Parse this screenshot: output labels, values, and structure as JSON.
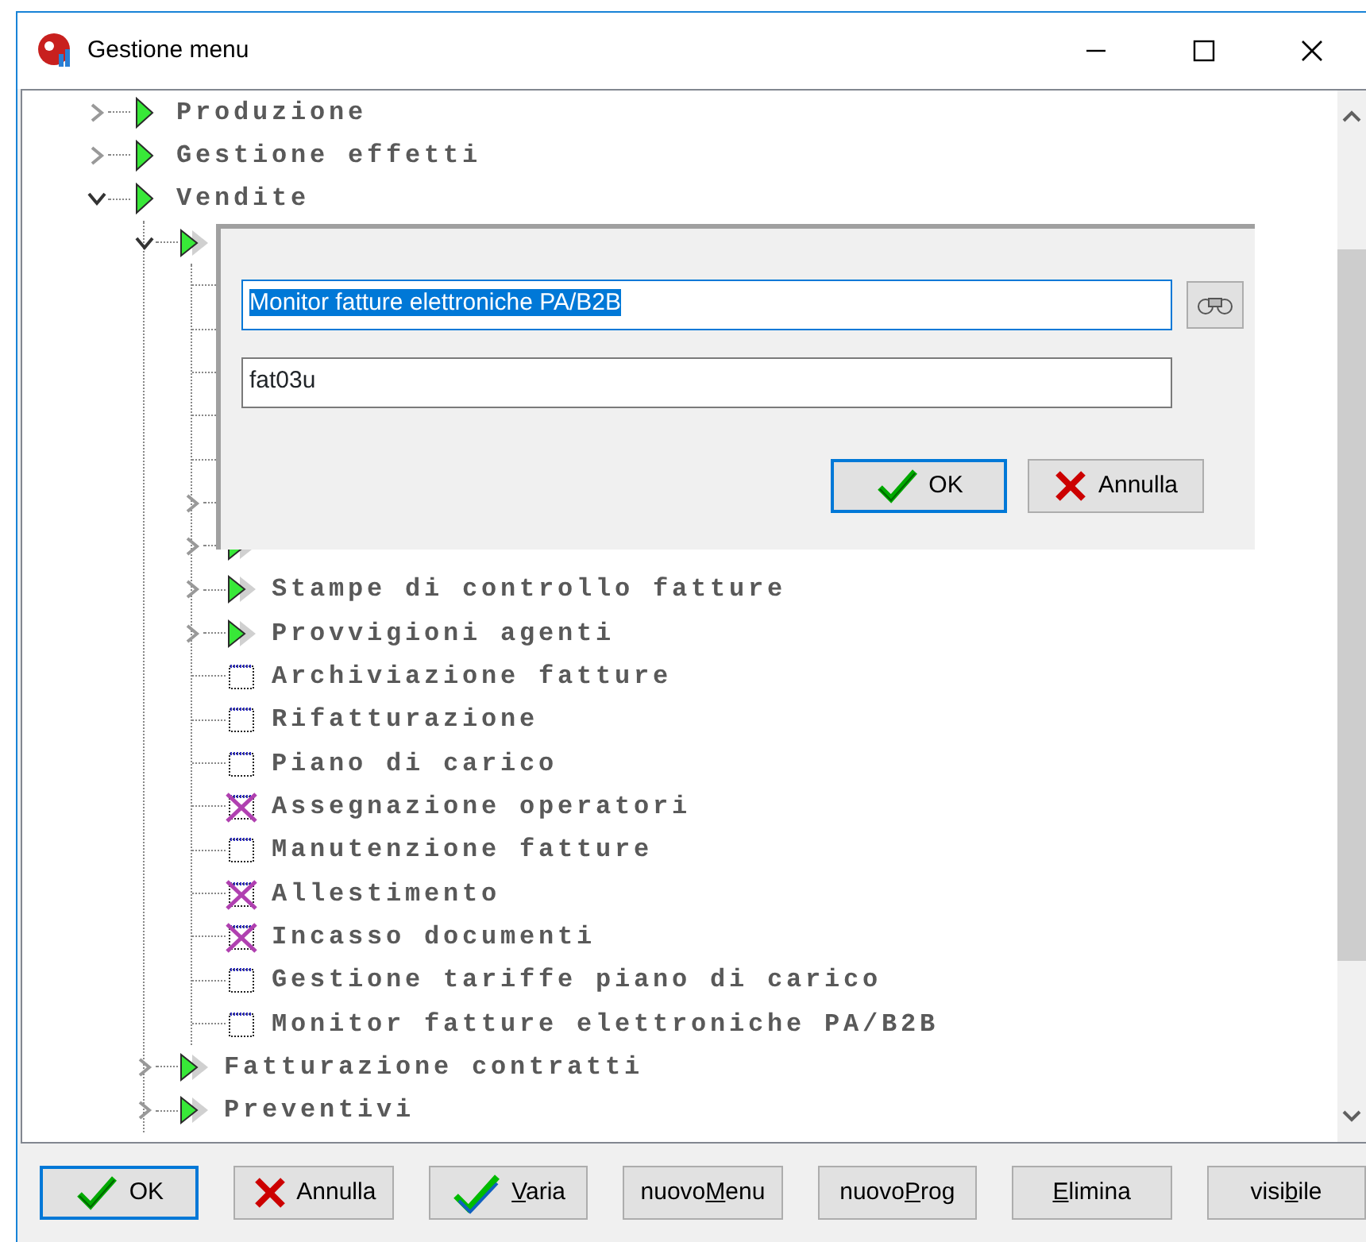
{
  "window": {
    "title": "Gestione menu"
  },
  "tree": [
    {
      "label": "Produzione",
      "kind": "menu",
      "expanded": false
    },
    {
      "label": "Gestione effetti",
      "kind": "menu",
      "expanded": false
    },
    {
      "label": "Vendite",
      "kind": "menu",
      "expanded": true,
      "children": [
        {
          "kind": "submenu",
          "expanded": true,
          "children": [
            {
              "kind": "covered"
            },
            {
              "kind": "covered"
            },
            {
              "kind": "covered"
            },
            {
              "kind": "covered"
            },
            {
              "kind": "covered"
            },
            {
              "kind": "covered-submenu",
              "expanded": false
            },
            {
              "kind": "submenu",
              "expanded": false
            },
            {
              "label": "Stampe di controllo fatture",
              "kind": "submenu",
              "expanded": false
            },
            {
              "label": "Provvigioni agenti",
              "kind": "submenu",
              "expanded": false
            },
            {
              "label": "Archiviazione fatture",
              "kind": "program",
              "excluded": false
            },
            {
              "label": "Rifatturazione",
              "kind": "program",
              "excluded": false
            },
            {
              "label": "Piano di carico",
              "kind": "program",
              "excluded": false
            },
            {
              "label": "Assegnazione operatori",
              "kind": "program",
              "excluded": true
            },
            {
              "label": "Manutenzione fatture",
              "kind": "program",
              "excluded": false
            },
            {
              "label": "Allestimento",
              "kind": "program",
              "excluded": true
            },
            {
              "label": "Incasso documenti",
              "kind": "program",
              "excluded": true
            },
            {
              "label": "Gestione tariffe piano di carico",
              "kind": "program",
              "excluded": false
            },
            {
              "label": "Monitor fatture elettroniche PA/B2B",
              "kind": "program",
              "excluded": false
            }
          ]
        },
        {
          "label": "Fatturazione contratti",
          "kind": "submenu",
          "expanded": false
        },
        {
          "label": "Preventivi",
          "kind": "submenu",
          "expanded": false
        }
      ]
    }
  ],
  "edit_dialog": {
    "name_field": {
      "value": "Monitor fatture elettroniche PA/B2B",
      "selected": true
    },
    "program_field": {
      "value": "fat03u",
      "selected": false
    },
    "buttons": [
      {
        "label": "OK",
        "kind": "confirm",
        "default": true
      },
      {
        "label": "Annulla",
        "kind": "cancel",
        "default": false
      }
    ]
  },
  "buttons": [
    {
      "label": "OK",
      "kind": "confirm",
      "default": true
    },
    {
      "label": "Annulla",
      "kind": "cancel",
      "default": false
    },
    {
      "key": "V",
      "after": "aria",
      "kind": "modify",
      "default": false
    },
    {
      "before": "nuovo",
      "key": "M",
      "after": "enu",
      "kind": "plain",
      "default": false
    },
    {
      "before": "nuovo",
      "key": "P",
      "after": "rog",
      "kind": "plain",
      "default": false
    },
    {
      "key": "E",
      "after": "limina",
      "kind": "plain",
      "default": false
    },
    {
      "before": "visi",
      "key": "b",
      "after": "ile",
      "kind": "plain",
      "default": false
    }
  ]
}
